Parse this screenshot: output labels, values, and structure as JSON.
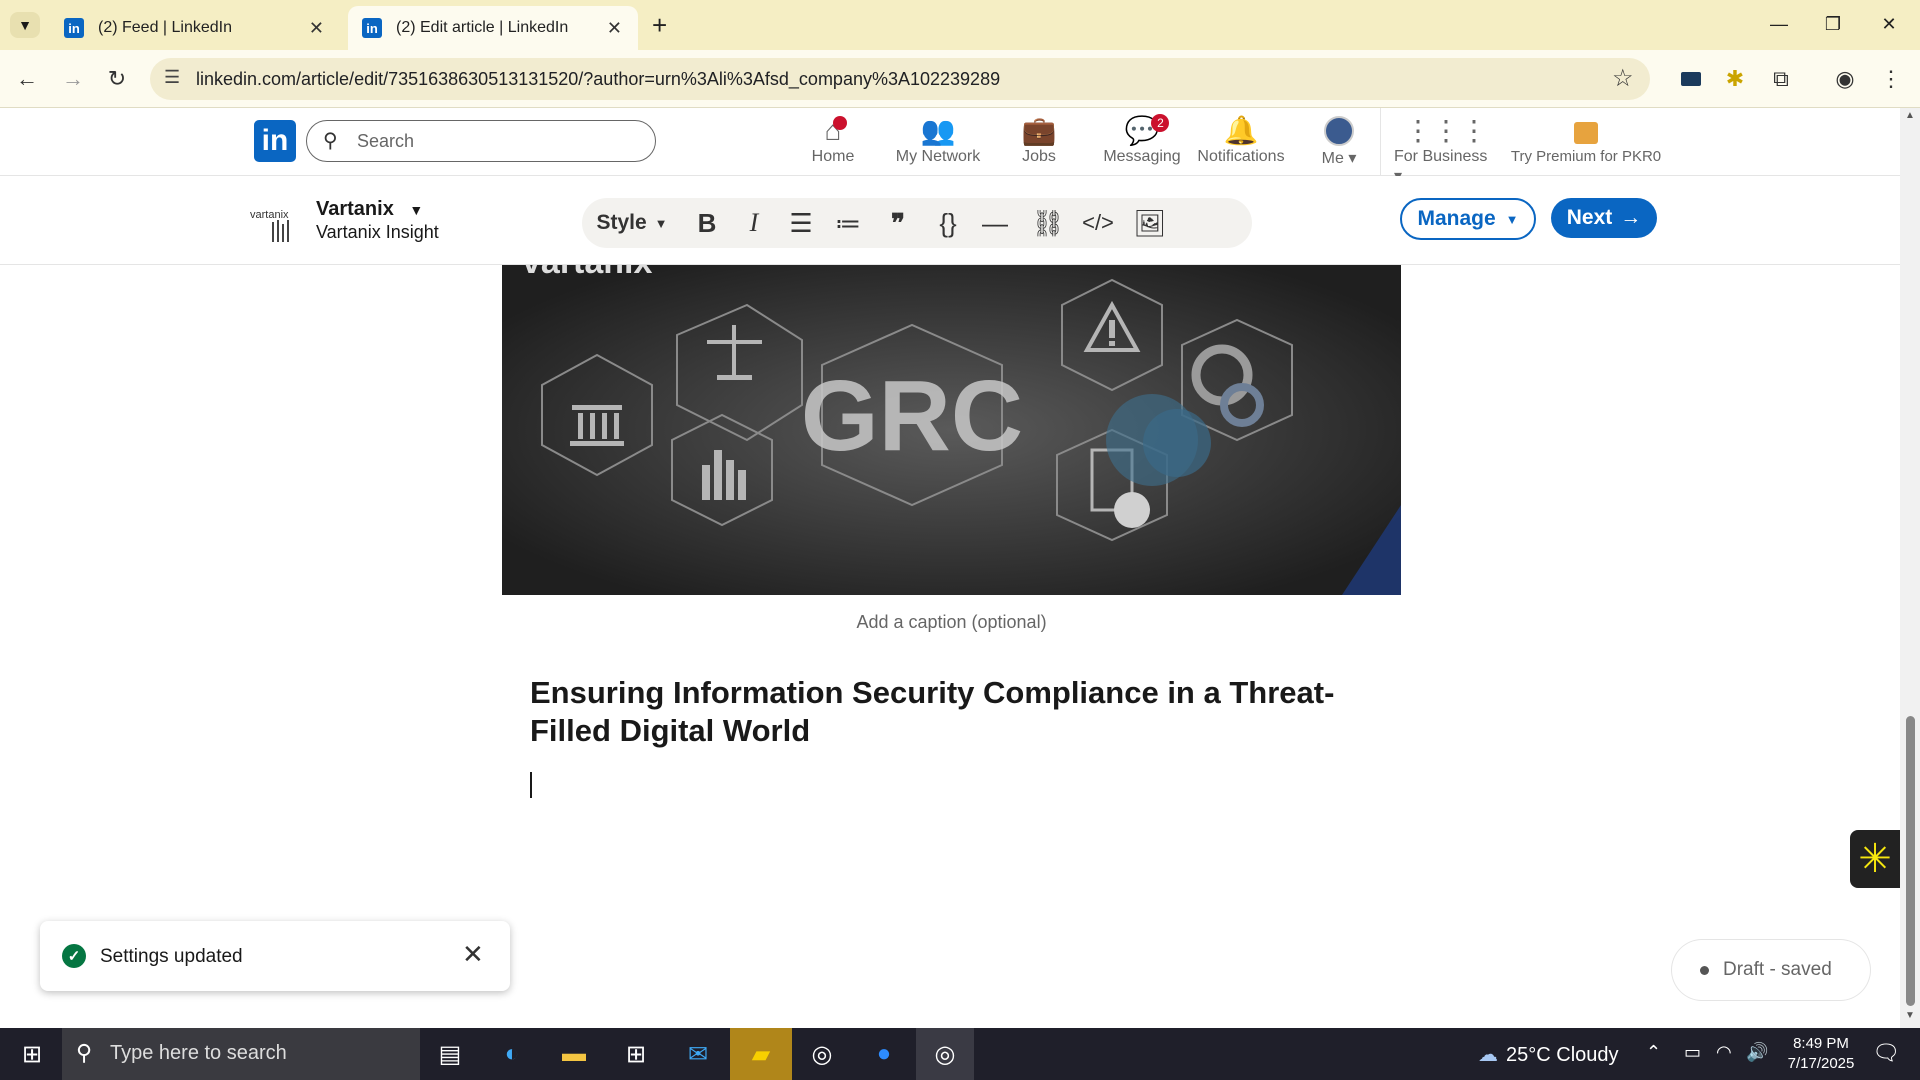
{
  "browser": {
    "tabs": [
      {
        "label": "(2) Feed | LinkedIn"
      },
      {
        "label": "(2) Edit article | LinkedIn"
      }
    ],
    "url": "linkedin.com/article/edit/7351638630513131520/?author=urn%3Ali%3Afsd_company%3A102239289"
  },
  "linkedin": {
    "search_placeholder": "Search",
    "nav": [
      {
        "label": "Home",
        "icon": "home-icon",
        "badge": ""
      },
      {
        "label": "My Network",
        "icon": "network-icon",
        "badge": ""
      },
      {
        "label": "Jobs",
        "icon": "jobs-icon",
        "badge": ""
      },
      {
        "label": "Messaging",
        "icon": "messaging-icon",
        "badge": "2"
      },
      {
        "label": "Notifications",
        "icon": "bell-icon",
        "badge": ""
      },
      {
        "label": "Me",
        "icon": "avatar",
        "badge": ""
      },
      {
        "label": "For Business",
        "icon": "grid-icon",
        "badge": ""
      },
      {
        "label": "Try Premium for PKR0",
        "icon": "premium-icon",
        "badge": ""
      }
    ]
  },
  "editor": {
    "company_name": "Vartanix",
    "company_sub": "Vartanix Insight",
    "style_label": "Style",
    "manage_label": "Manage",
    "next_label": "Next"
  },
  "article": {
    "caption_placeholder": "Add a caption (optional)",
    "title": "Ensuring Information Security Compliance in a Threat-Filled Digital World",
    "image_text": "GRC",
    "image_brand": "vartanix"
  },
  "toast": {
    "text": "Settings updated"
  },
  "draft_status": "Draft - saved",
  "taskbar": {
    "search_placeholder": "Type here to search",
    "weather": "25°C  Cloudy",
    "time": "8:49 PM",
    "date": "7/17/2025"
  },
  "colors": {
    "linkedin_blue": "#0a66c2",
    "tab_strip": "#f5eec4",
    "badge_red": "#cb112d",
    "success_green": "#057642"
  }
}
